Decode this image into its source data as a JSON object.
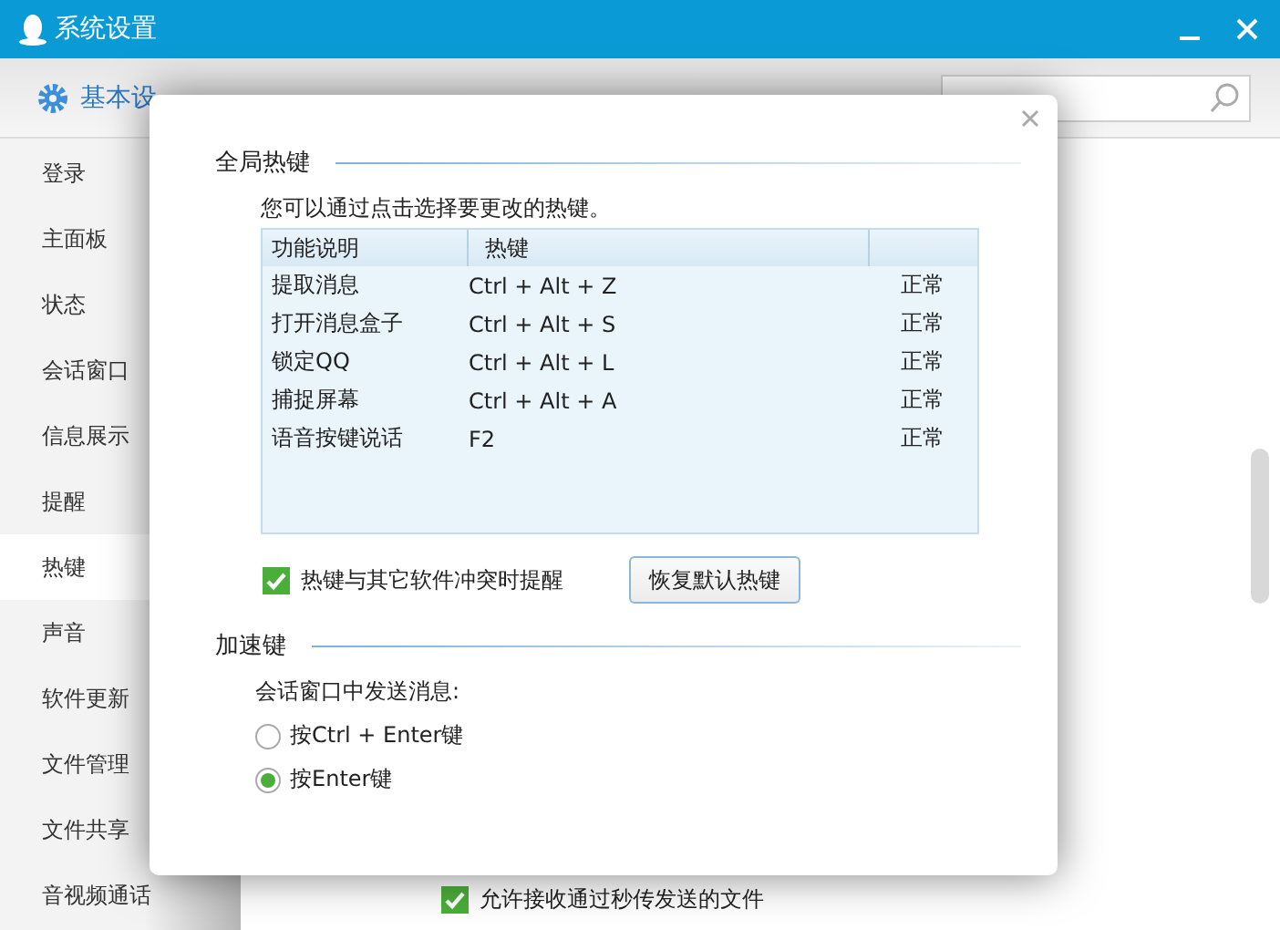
{
  "window": {
    "title": "系统设置"
  },
  "toolbar": {
    "tabs": [
      {
        "label": "基本设",
        "selected": true
      }
    ]
  },
  "sidebar": {
    "items": [
      {
        "label": "登录",
        "selected": false
      },
      {
        "label": "主面板",
        "selected": false
      },
      {
        "label": "状态",
        "selected": false
      },
      {
        "label": "会话窗口",
        "selected": false
      },
      {
        "label": "信息展示",
        "selected": false
      },
      {
        "label": "提醒",
        "selected": false
      },
      {
        "label": "热键",
        "selected": true
      },
      {
        "label": "声音",
        "selected": false
      },
      {
        "label": "软件更新",
        "selected": false
      },
      {
        "label": "文件管理",
        "selected": false
      },
      {
        "label": "文件共享",
        "selected": false
      },
      {
        "label": "音视频通话",
        "selected": false
      }
    ]
  },
  "background_content": {
    "checkbox": {
      "label": "允许接收通过秒传发送的文件",
      "checked": true
    }
  },
  "dialog": {
    "global_hotkeys": {
      "title": "全局热键",
      "hint": "您可以通过点击选择要更改的热键。",
      "table": {
        "columns": [
          "功能说明",
          "热键"
        ],
        "rows": [
          {
            "function": "提取消息",
            "hotkey": "Ctrl + Alt + Z",
            "status": "正常"
          },
          {
            "function": "打开消息盒子",
            "hotkey": "Ctrl + Alt + S",
            "status": "正常"
          },
          {
            "function": "锁定QQ",
            "hotkey": "Ctrl + Alt + L",
            "status": "正常"
          },
          {
            "function": "捕捉屏幕",
            "hotkey": "Ctrl + Alt + A",
            "status": "正常"
          },
          {
            "function": "语音按键说话",
            "hotkey": "F2",
            "status": "正常"
          }
        ]
      },
      "conflict_checkbox": {
        "label": "热键与其它软件冲突时提醒",
        "checked": true
      },
      "restore_button": "恢复默认热键"
    },
    "accelerator": {
      "title": "加速键",
      "label": "会话窗口中发送消息:",
      "options": [
        {
          "label": "按Ctrl + Enter键",
          "selected": false
        },
        {
          "label": "按Enter键",
          "selected": true
        }
      ]
    }
  }
}
